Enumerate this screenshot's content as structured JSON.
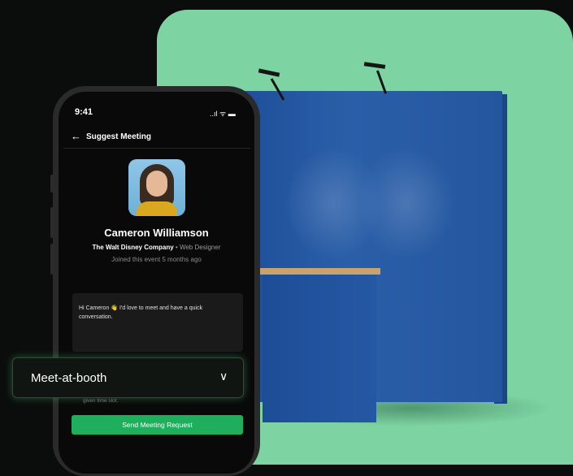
{
  "status": {
    "time": "9:41",
    "icons": "..ıl ᯤ ▬"
  },
  "nav": {
    "back_icon": "←",
    "title": "Suggest Meeting"
  },
  "profile": {
    "name": "Cameron Williamson",
    "company": "The Walt Disney Company",
    "separator": "•",
    "role": "Web Designer",
    "joined": "Joined this event 5 months ago"
  },
  "message": {
    "text": "Hi Cameron 👋 I'd love to meet and have a quick conversation."
  },
  "meeting_type": {
    "value": "Meet-at-booth",
    "chevron": "∨"
  },
  "hint": "given time slot.",
  "send_button": {
    "label": "Send Meeting Request"
  },
  "colors": {
    "accent_green": "#1fae5b",
    "panel_green": "#7dd3a2",
    "booth_blue": "#2558a3"
  }
}
